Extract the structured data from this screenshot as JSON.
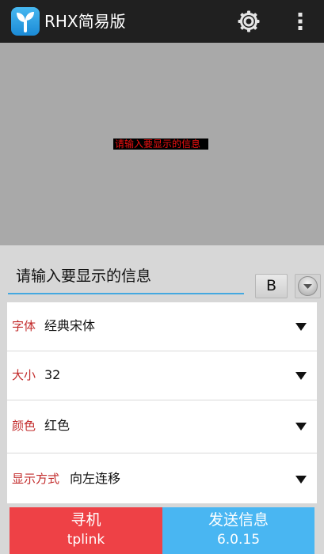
{
  "app": {
    "title": "RHX简易版",
    "logo_icon": "leaf-sprout-icon",
    "settings_icon": "gear-icon",
    "overflow_icon": "more-vertical-icon"
  },
  "preview": {
    "text": "请输入要显示的信息",
    "text_color": "#ee1111",
    "bg_color": "#000000"
  },
  "message_input": {
    "placeholder": "请输入要显示的信息",
    "value": ""
  },
  "toolbar": {
    "bold_label": "B",
    "expand_icon": "chevron-down-circle-icon"
  },
  "settings": [
    {
      "label": "字体",
      "value": "经典宋体"
    },
    {
      "label": "大小",
      "value": "32"
    },
    {
      "label": "颜色",
      "value": "红色"
    },
    {
      "label": "显示方式",
      "value": "向左连移"
    }
  ],
  "buttons": {
    "find": {
      "line1": "寻机",
      "line2": "tplink",
      "color": "#ee4146"
    },
    "send": {
      "line1": "发送信息",
      "line2": "6.0.15",
      "color": "#49b6f2"
    }
  },
  "colors": {
    "accent": "#44a8e0",
    "label_red": "#c22a2a"
  }
}
